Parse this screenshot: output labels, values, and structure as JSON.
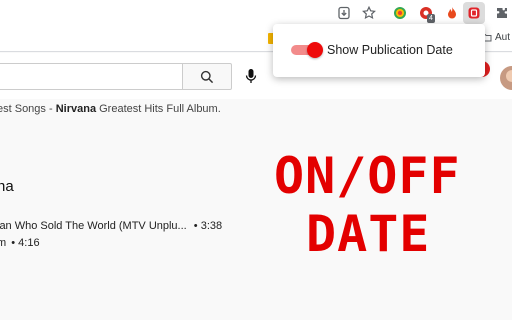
{
  "browser": {
    "extension_badge_count": "4",
    "bookmark_folder_label": "Aut"
  },
  "youtube": {
    "search": {
      "value": "",
      "placeholder": ""
    }
  },
  "page": {
    "breadcrumb_prefix": "est Songs - ",
    "breadcrumb_bold": "Nirvana",
    "breadcrumb_suffix": " Greatest Hits Full Album.",
    "playlist_title": "na",
    "videos": [
      {
        "title": "lan Who Sold The World (MTV Unplu...",
        "separator": "•",
        "duration": "3:38"
      },
      {
        "title": "m",
        "separator": "•",
        "duration": "4:16"
      }
    ]
  },
  "overlay": {
    "line1": "ON/OFF",
    "line2": "DATE"
  },
  "extension_popup": {
    "toggle_label": "Show Publication Date",
    "toggle_on": true
  },
  "colors": {
    "promo_red": "#e30000",
    "toggle_red": "#ee0a0a",
    "toggle_track": "#f28b8b"
  }
}
